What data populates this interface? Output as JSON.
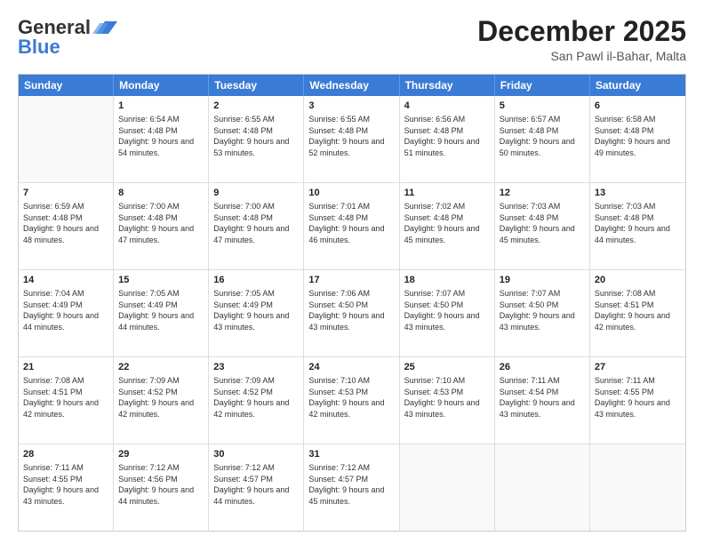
{
  "header": {
    "logo_general": "General",
    "logo_blue": "Blue",
    "month_year": "December 2025",
    "location": "San Pawl il-Bahar, Malta"
  },
  "days_of_week": [
    "Sunday",
    "Monday",
    "Tuesday",
    "Wednesday",
    "Thursday",
    "Friday",
    "Saturday"
  ],
  "weeks": [
    [
      {
        "day": "",
        "sunrise": "",
        "sunset": "",
        "daylight": ""
      },
      {
        "day": "1",
        "sunrise": "Sunrise: 6:54 AM",
        "sunset": "Sunset: 4:48 PM",
        "daylight": "Daylight: 9 hours and 54 minutes."
      },
      {
        "day": "2",
        "sunrise": "Sunrise: 6:55 AM",
        "sunset": "Sunset: 4:48 PM",
        "daylight": "Daylight: 9 hours and 53 minutes."
      },
      {
        "day": "3",
        "sunrise": "Sunrise: 6:55 AM",
        "sunset": "Sunset: 4:48 PM",
        "daylight": "Daylight: 9 hours and 52 minutes."
      },
      {
        "day": "4",
        "sunrise": "Sunrise: 6:56 AM",
        "sunset": "Sunset: 4:48 PM",
        "daylight": "Daylight: 9 hours and 51 minutes."
      },
      {
        "day": "5",
        "sunrise": "Sunrise: 6:57 AM",
        "sunset": "Sunset: 4:48 PM",
        "daylight": "Daylight: 9 hours and 50 minutes."
      },
      {
        "day": "6",
        "sunrise": "Sunrise: 6:58 AM",
        "sunset": "Sunset: 4:48 PM",
        "daylight": "Daylight: 9 hours and 49 minutes."
      }
    ],
    [
      {
        "day": "7",
        "sunrise": "Sunrise: 6:59 AM",
        "sunset": "Sunset: 4:48 PM",
        "daylight": "Daylight: 9 hours and 48 minutes."
      },
      {
        "day": "8",
        "sunrise": "Sunrise: 7:00 AM",
        "sunset": "Sunset: 4:48 PM",
        "daylight": "Daylight: 9 hours and 47 minutes."
      },
      {
        "day": "9",
        "sunrise": "Sunrise: 7:00 AM",
        "sunset": "Sunset: 4:48 PM",
        "daylight": "Daylight: 9 hours and 47 minutes."
      },
      {
        "day": "10",
        "sunrise": "Sunrise: 7:01 AM",
        "sunset": "Sunset: 4:48 PM",
        "daylight": "Daylight: 9 hours and 46 minutes."
      },
      {
        "day": "11",
        "sunrise": "Sunrise: 7:02 AM",
        "sunset": "Sunset: 4:48 PM",
        "daylight": "Daylight: 9 hours and 45 minutes."
      },
      {
        "day": "12",
        "sunrise": "Sunrise: 7:03 AM",
        "sunset": "Sunset: 4:48 PM",
        "daylight": "Daylight: 9 hours and 45 minutes."
      },
      {
        "day": "13",
        "sunrise": "Sunrise: 7:03 AM",
        "sunset": "Sunset: 4:48 PM",
        "daylight": "Daylight: 9 hours and 44 minutes."
      }
    ],
    [
      {
        "day": "14",
        "sunrise": "Sunrise: 7:04 AM",
        "sunset": "Sunset: 4:49 PM",
        "daylight": "Daylight: 9 hours and 44 minutes."
      },
      {
        "day": "15",
        "sunrise": "Sunrise: 7:05 AM",
        "sunset": "Sunset: 4:49 PM",
        "daylight": "Daylight: 9 hours and 44 minutes."
      },
      {
        "day": "16",
        "sunrise": "Sunrise: 7:05 AM",
        "sunset": "Sunset: 4:49 PM",
        "daylight": "Daylight: 9 hours and 43 minutes."
      },
      {
        "day": "17",
        "sunrise": "Sunrise: 7:06 AM",
        "sunset": "Sunset: 4:50 PM",
        "daylight": "Daylight: 9 hours and 43 minutes."
      },
      {
        "day": "18",
        "sunrise": "Sunrise: 7:07 AM",
        "sunset": "Sunset: 4:50 PM",
        "daylight": "Daylight: 9 hours and 43 minutes."
      },
      {
        "day": "19",
        "sunrise": "Sunrise: 7:07 AM",
        "sunset": "Sunset: 4:50 PM",
        "daylight": "Daylight: 9 hours and 43 minutes."
      },
      {
        "day": "20",
        "sunrise": "Sunrise: 7:08 AM",
        "sunset": "Sunset: 4:51 PM",
        "daylight": "Daylight: 9 hours and 42 minutes."
      }
    ],
    [
      {
        "day": "21",
        "sunrise": "Sunrise: 7:08 AM",
        "sunset": "Sunset: 4:51 PM",
        "daylight": "Daylight: 9 hours and 42 minutes."
      },
      {
        "day": "22",
        "sunrise": "Sunrise: 7:09 AM",
        "sunset": "Sunset: 4:52 PM",
        "daylight": "Daylight: 9 hours and 42 minutes."
      },
      {
        "day": "23",
        "sunrise": "Sunrise: 7:09 AM",
        "sunset": "Sunset: 4:52 PM",
        "daylight": "Daylight: 9 hours and 42 minutes."
      },
      {
        "day": "24",
        "sunrise": "Sunrise: 7:10 AM",
        "sunset": "Sunset: 4:53 PM",
        "daylight": "Daylight: 9 hours and 42 minutes."
      },
      {
        "day": "25",
        "sunrise": "Sunrise: 7:10 AM",
        "sunset": "Sunset: 4:53 PM",
        "daylight": "Daylight: 9 hours and 43 minutes."
      },
      {
        "day": "26",
        "sunrise": "Sunrise: 7:11 AM",
        "sunset": "Sunset: 4:54 PM",
        "daylight": "Daylight: 9 hours and 43 minutes."
      },
      {
        "day": "27",
        "sunrise": "Sunrise: 7:11 AM",
        "sunset": "Sunset: 4:55 PM",
        "daylight": "Daylight: 9 hours and 43 minutes."
      }
    ],
    [
      {
        "day": "28",
        "sunrise": "Sunrise: 7:11 AM",
        "sunset": "Sunset: 4:55 PM",
        "daylight": "Daylight: 9 hours and 43 minutes."
      },
      {
        "day": "29",
        "sunrise": "Sunrise: 7:12 AM",
        "sunset": "Sunset: 4:56 PM",
        "daylight": "Daylight: 9 hours and 44 minutes."
      },
      {
        "day": "30",
        "sunrise": "Sunrise: 7:12 AM",
        "sunset": "Sunset: 4:57 PM",
        "daylight": "Daylight: 9 hours and 44 minutes."
      },
      {
        "day": "31",
        "sunrise": "Sunrise: 7:12 AM",
        "sunset": "Sunset: 4:57 PM",
        "daylight": "Daylight: 9 hours and 45 minutes."
      },
      {
        "day": "",
        "sunrise": "",
        "sunset": "",
        "daylight": ""
      },
      {
        "day": "",
        "sunrise": "",
        "sunset": "",
        "daylight": ""
      },
      {
        "day": "",
        "sunrise": "",
        "sunset": "",
        "daylight": ""
      }
    ]
  ]
}
